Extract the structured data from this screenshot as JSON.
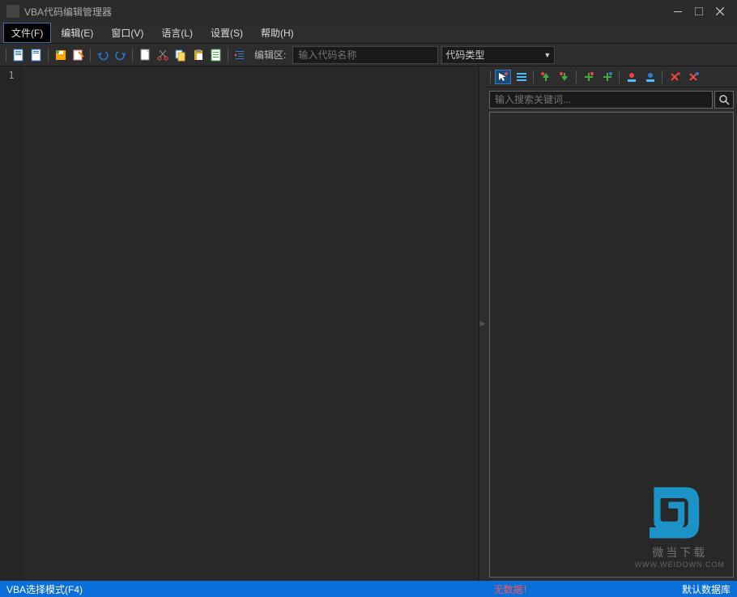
{
  "title": "VBA代码编辑管理器",
  "menu": {
    "file": "文件(F)",
    "edit": "编辑(E)",
    "window": "窗口(V)",
    "language": "语言(L)",
    "settings": "设置(S)",
    "help": "帮助(H)"
  },
  "toolbar": {
    "edit_area_label": "编辑区:",
    "code_name_placeholder": "输入代码名称",
    "code_type": "代码类型"
  },
  "editor": {
    "line1": "1"
  },
  "sidepanel": {
    "search_placeholder": "输入搜索关键词..."
  },
  "watermark": {
    "text": "微当下载",
    "url": "WWW.WEIDOWN.COM"
  },
  "status": {
    "mode": "VBA选择模式(F4)",
    "center": "无数据！",
    "right": "默认数据库"
  }
}
